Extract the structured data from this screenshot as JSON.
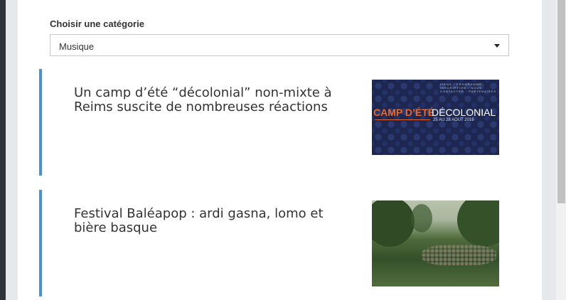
{
  "category": {
    "label": "Choisir une catégorie",
    "selected": "Musique"
  },
  "articles": [
    {
      "title": "Un camp d’été “décolonial” non-mixte à Reims suscite de nombreuses réactions",
      "image": {
        "nav": "LIENS · PROGRAMME · INSCRIPTION · NOUS CONTACTER · PARTENAIRES",
        "headline_left": "CAMP D’ÉTÉ",
        "headline_right": "DÉCOLONIAL",
        "dates": "25 AU 28 AOUT 2016"
      }
    },
    {
      "title": "Festival Baléapop : ardi gasna, lomo et bière basque"
    }
  ],
  "colors": {
    "accent_bar": "#4a90d9",
    "camp_orange": "#e8682a",
    "thumb_navy": "#1d2750"
  }
}
